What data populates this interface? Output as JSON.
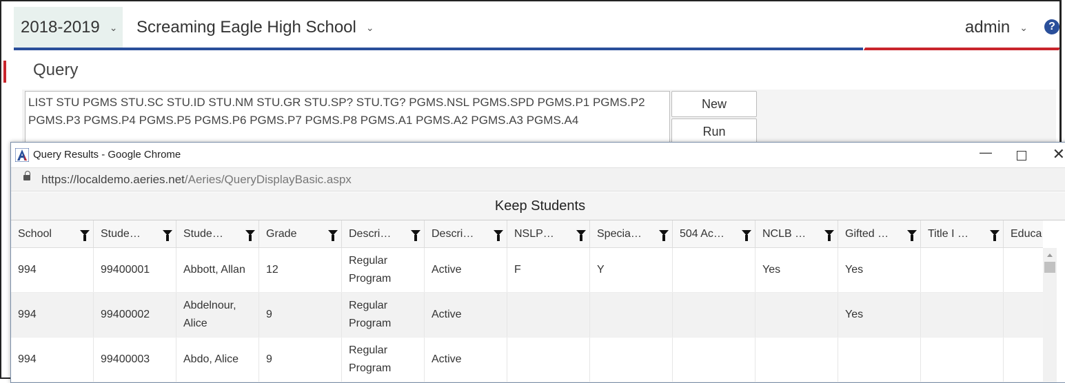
{
  "header": {
    "year": "2018-2019",
    "school": "Screaming Eagle High School",
    "user": "admin",
    "help": "?"
  },
  "query": {
    "title": "Query",
    "text": "LIST STU PGMS STU.SC STU.ID STU.NM STU.GR STU.SP? STU.TG? PGMS.NSL PGMS.SPD PGMS.P1 PGMS.P2 PGMS.P3 PGMS.P4 PGMS.P5 PGMS.P6 PGMS.P7 PGMS.P8 PGMS.A1 PGMS.A2 PGMS.A3 PGMS.A4",
    "new_label": "New",
    "run_label": "Run"
  },
  "popup": {
    "title": "Query Results - Google Chrome",
    "url_host": "https://localdemo.aeries.net",
    "url_path": "/Aeries/QueryDisplayBasic.aspx",
    "keep_label": "Keep Students"
  },
  "columns": [
    "School",
    "Stude…",
    "Stude…",
    "Grade",
    "Descri…",
    "Descri…",
    "NSLP…",
    "Specia…",
    "504 Ac…",
    "NCLB …",
    "Gifted …",
    "Title I …",
    "Educa"
  ],
  "rows": [
    [
      "994",
      "99400001",
      "Abbott, Allan",
      "12",
      "Regular Program",
      "Active",
      "F",
      "Y",
      "",
      "Yes",
      "Yes",
      "",
      ""
    ],
    [
      "994",
      "99400002",
      "Abdelnour, Alice",
      "9",
      "Regular Program",
      "Active",
      "",
      "",
      "",
      "",
      "Yes",
      "",
      ""
    ],
    [
      "994",
      "99400003",
      "Abdo, Alice",
      "9",
      "Regular Program",
      "Active",
      "",
      "",
      "",
      "",
      "",
      "",
      ""
    ]
  ],
  "colors": {
    "brand_blue": "#2a4f9a",
    "brand_red": "#c9252c"
  }
}
